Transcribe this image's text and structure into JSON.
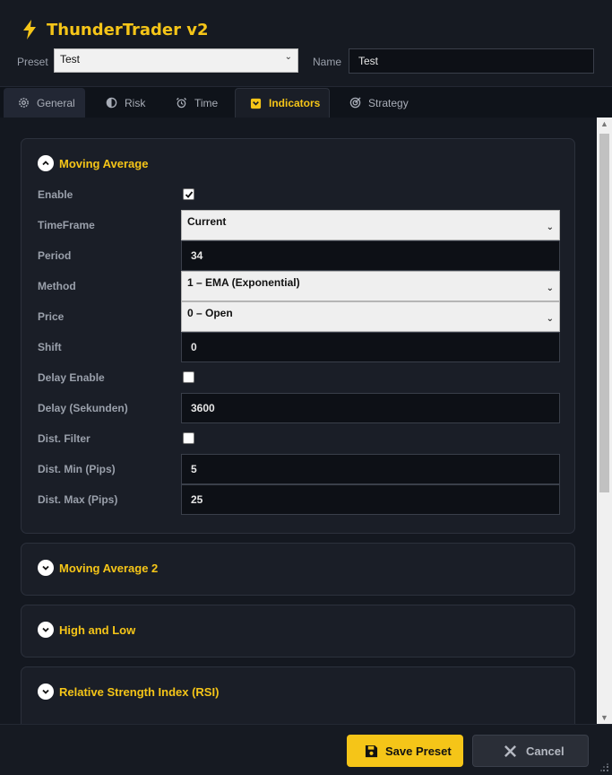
{
  "app": {
    "title": "ThunderTrader v2"
  },
  "header": {
    "preset_label": "Preset",
    "preset_value": "Test",
    "name_label": "Name",
    "name_value": "Test"
  },
  "tabs": [
    {
      "label": "General",
      "icon": "gear-icon"
    },
    {
      "label": "Risk",
      "icon": "half-circle-icon"
    },
    {
      "label": "Time",
      "icon": "alarm-clock-icon"
    },
    {
      "label": "Indicators",
      "icon": "indicator-icon",
      "active": true
    },
    {
      "label": "Strategy",
      "icon": "target-icon"
    }
  ],
  "panels": {
    "ma": {
      "title": "Moving Average",
      "expanded": true,
      "enable_label": "Enable",
      "enable_checked": true,
      "timeframe_label": "TimeFrame",
      "timeframe_value": "Current",
      "period_label": "Period",
      "period_value": "34",
      "method_label": "Method",
      "method_value": "1 – EMA (Exponential)",
      "price_label": "Price",
      "price_value": "0 – Open",
      "shift_label": "Shift",
      "shift_value": "0",
      "delay_enable_label": "Delay Enable",
      "delay_enable_checked": false,
      "delay_label": "Delay (Sekunden)",
      "delay_value": "3600",
      "dist_filter_label": "Dist. Filter",
      "dist_filter_checked": false,
      "dist_min_label": "Dist. Min (Pips)",
      "dist_min_value": "5",
      "dist_max_label": "Dist. Max (Pips)",
      "dist_max_value": "25"
    },
    "ma2": {
      "title": "Moving Average 2"
    },
    "highlow": {
      "title": "High and Low"
    },
    "rsi": {
      "title": "Relative Strength Index (RSI)"
    }
  },
  "footer": {
    "save_label": "Save Preset",
    "cancel_label": "Cancel"
  },
  "colors": {
    "accent": "#f5c518",
    "background": "#0f131a",
    "panel": "#1a1e27"
  }
}
